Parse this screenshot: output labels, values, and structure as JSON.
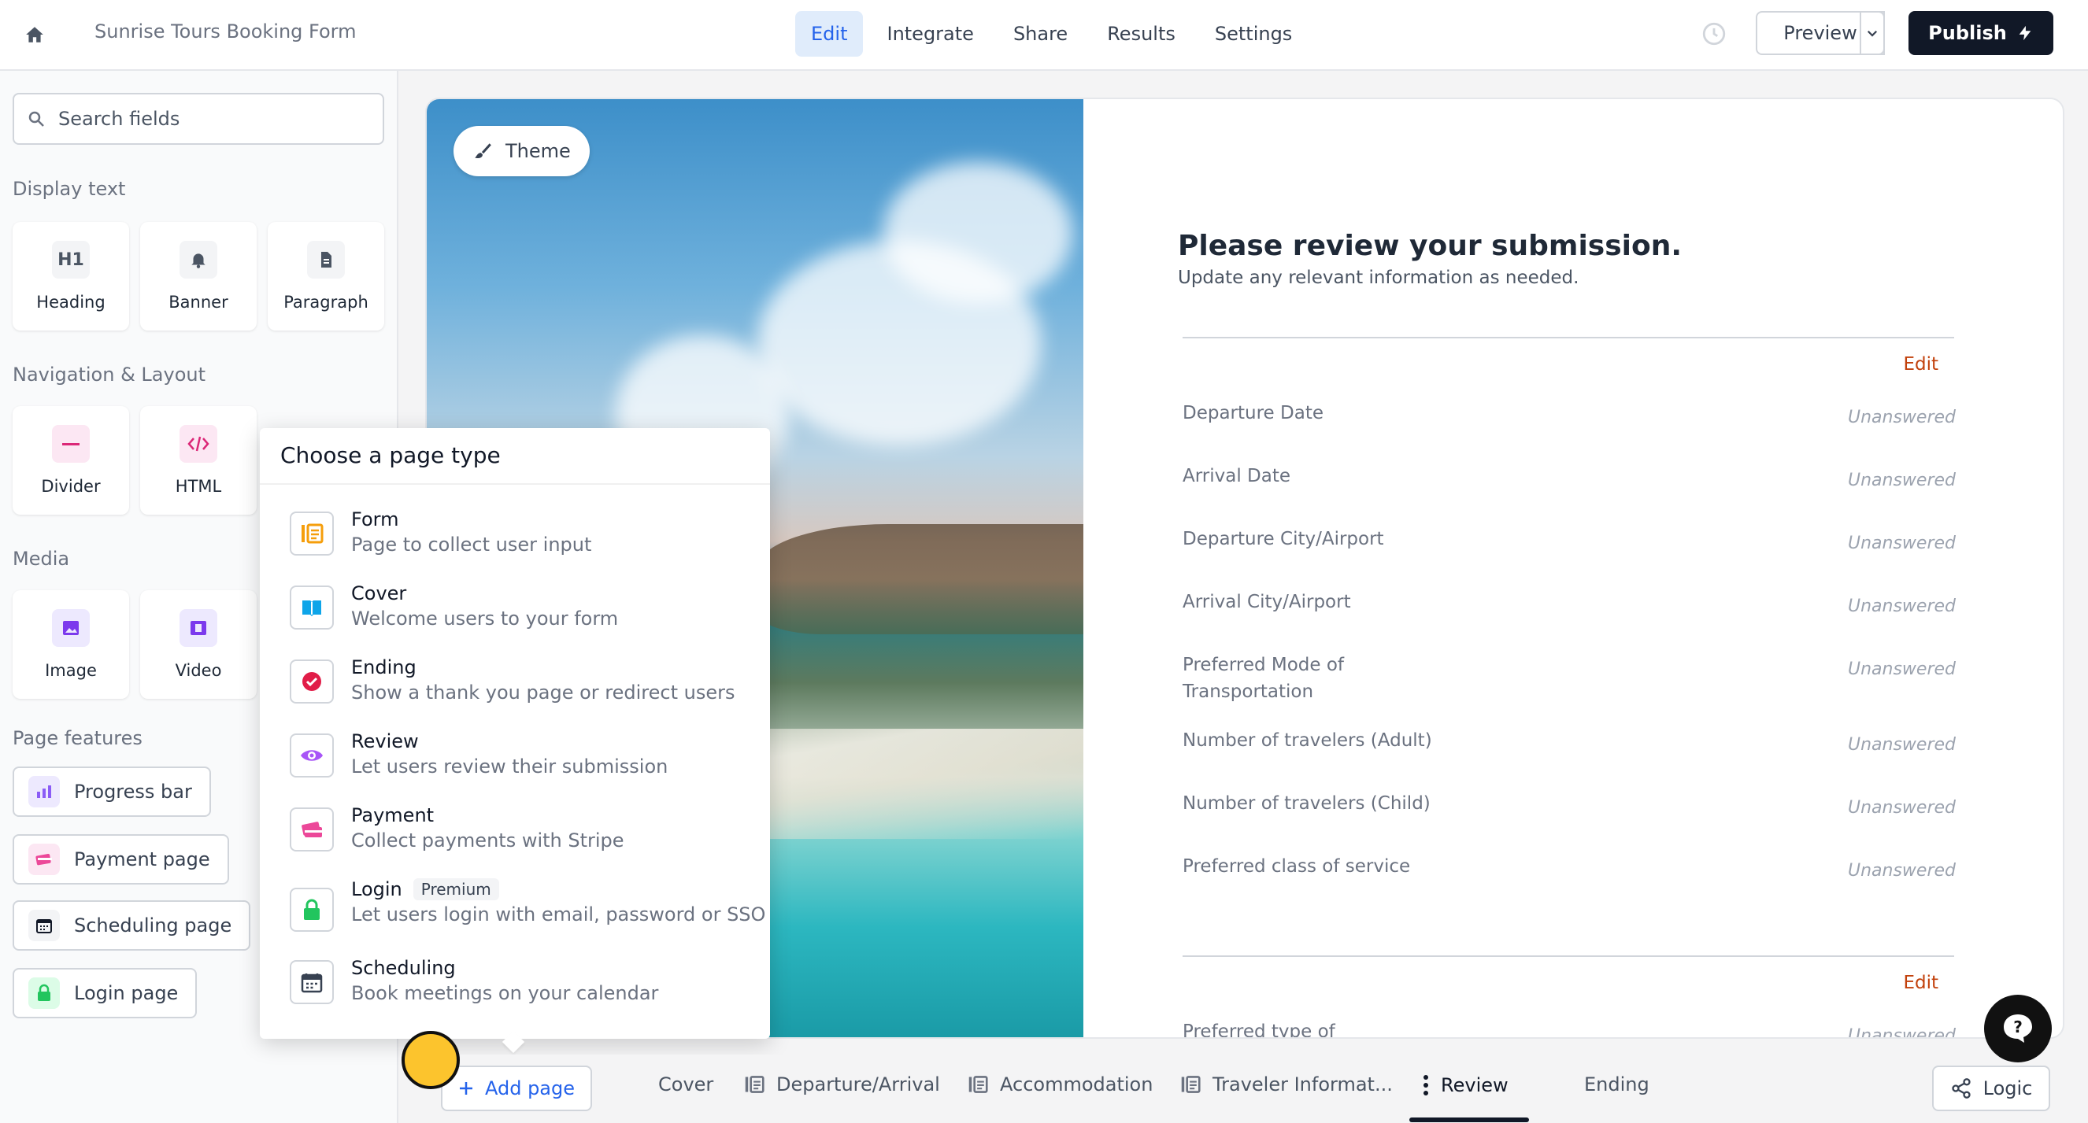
{
  "header": {
    "form_title": "Sunrise Tours Booking Form",
    "tabs": [
      {
        "label": "Edit",
        "active": true
      },
      {
        "label": "Integrate"
      },
      {
        "label": "Share"
      },
      {
        "label": "Results"
      },
      {
        "label": "Settings"
      }
    ],
    "preview_label": "Preview",
    "publish_label": "Publish"
  },
  "sidebar": {
    "search_placeholder": "Search fields",
    "display_text_label": "Display text",
    "display_text_items": [
      {
        "label": "Heading",
        "icon": "heading-icon"
      },
      {
        "label": "Banner",
        "icon": "bell-icon"
      },
      {
        "label": "Paragraph",
        "icon": "document-icon"
      }
    ],
    "nav_layout_label": "Navigation & Layout",
    "nav_layout_items": [
      {
        "label": "Divider",
        "icon": "divider-icon"
      },
      {
        "label": "HTML",
        "icon": "code-icon"
      }
    ],
    "media_label": "Media",
    "media_items": [
      {
        "label": "Image",
        "icon": "image-icon"
      },
      {
        "label": "Video",
        "icon": "film-icon"
      }
    ],
    "page_features_label": "Page features",
    "page_features": [
      {
        "label": "Progress bar",
        "icon": "bar-chart-icon"
      },
      {
        "label": "Payment page",
        "icon": "credit-card-icon"
      },
      {
        "label": "Scheduling page",
        "icon": "calendar-icon"
      },
      {
        "label": "Login page",
        "icon": "lock-icon"
      }
    ]
  },
  "canvas": {
    "theme_label": "Theme",
    "review_title": "Please review your submission.",
    "review_subtitle": "Update any relevant information as needed.",
    "edit_label": "Edit",
    "rows": [
      {
        "question": "Departure Date",
        "answer": "Unanswered"
      },
      {
        "question": "Arrival Date",
        "answer": "Unanswered"
      },
      {
        "question": "Departure City/Airport",
        "answer": "Unanswered"
      },
      {
        "question": "Arrival City/Airport",
        "answer": "Unanswered"
      },
      {
        "question": "Preferred Mode of Transportation",
        "answer": "Unanswered"
      },
      {
        "question": "Number of travelers (Adult)",
        "answer": "Unanswered"
      },
      {
        "question": "Number of travelers (Child)",
        "answer": "Unanswered"
      },
      {
        "question": "Preferred class of service",
        "answer": "Unanswered"
      }
    ],
    "second_edit_label": "Edit",
    "partial_row": {
      "question": "Preferred type of",
      "answer": "Unanswered"
    }
  },
  "popup": {
    "title": "Choose a page type",
    "types": [
      {
        "name": "Form",
        "desc": "Page to collect user input",
        "icon": "form-icon",
        "color": "#f59e0b"
      },
      {
        "name": "Cover",
        "desc": "Welcome users to your form",
        "icon": "book-icon",
        "color": "#0ea5e9"
      },
      {
        "name": "Ending",
        "desc": "Show a thank you page or redirect users",
        "icon": "check-circle-icon",
        "color": "#e11d48"
      },
      {
        "name": "Review",
        "desc": "Let users review their submission",
        "icon": "eye-icon",
        "color": "#a855f7"
      },
      {
        "name": "Payment",
        "desc": "Collect payments with Stripe",
        "icon": "credit-card-icon",
        "color": "#ec4899"
      },
      {
        "name": "Login",
        "desc": "Let users login with email, password or SSO",
        "icon": "lock-icon",
        "color": "#22c55e",
        "badge": "Premium"
      },
      {
        "name": "Scheduling",
        "desc": "Book meetings on your calendar",
        "icon": "calendar-icon",
        "color": "#374151"
      }
    ]
  },
  "bottom": {
    "add_page_label": "Add page",
    "pages": [
      {
        "label": "Cover"
      },
      {
        "label": "Departure/Arrival"
      },
      {
        "label": "Accommodation"
      },
      {
        "label": "Traveler Informat..."
      },
      {
        "label": "Review",
        "active": true
      },
      {
        "label": "Ending"
      }
    ],
    "logic_label": "Logic"
  },
  "colors": {
    "accent": "#2563eb",
    "publish_bg": "#111827",
    "edit_link": "#c2410c"
  }
}
